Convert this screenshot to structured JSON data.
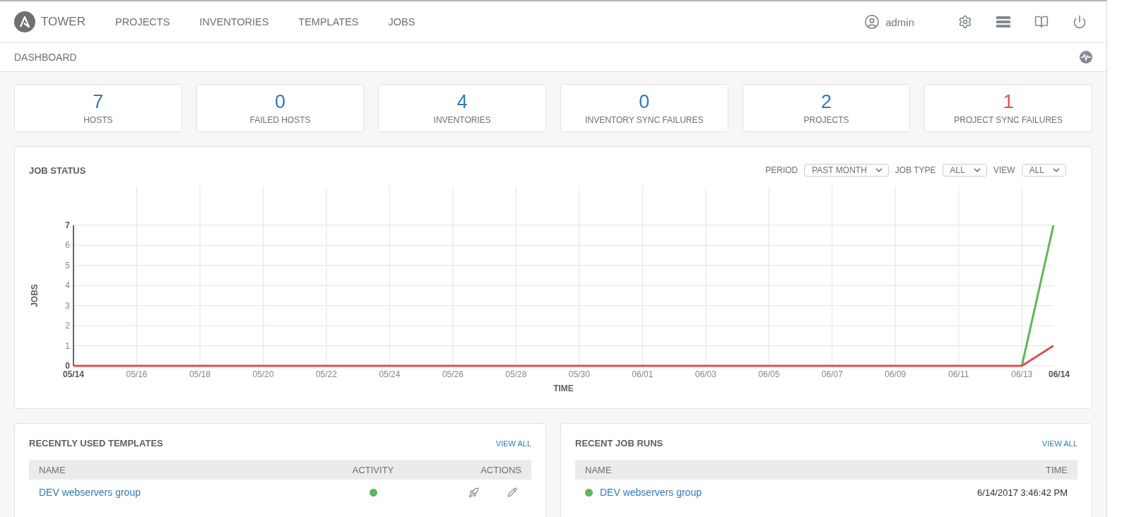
{
  "brand": {
    "name": "TOWER"
  },
  "nav": [
    {
      "label": "PROJECTS"
    },
    {
      "label": "INVENTORIES"
    },
    {
      "label": "TEMPLATES"
    },
    {
      "label": "JOBS"
    }
  ],
  "user": {
    "name": "admin"
  },
  "breadcrumb": "DASHBOARD",
  "counts": [
    {
      "value": "7",
      "label": "HOSTS",
      "color": "#337ab7"
    },
    {
      "value": "0",
      "label": "FAILED HOSTS",
      "color": "#337ab7"
    },
    {
      "value": "4",
      "label": "INVENTORIES",
      "color": "#337ab7"
    },
    {
      "value": "0",
      "label": "INVENTORY SYNC FAILURES",
      "color": "#337ab7"
    },
    {
      "value": "2",
      "label": "PROJECTS",
      "color": "#337ab7"
    },
    {
      "value": "1",
      "label": "PROJECT SYNC FAILURES",
      "color": "#d9534f"
    }
  ],
  "job_status": {
    "title": "JOB STATUS",
    "filters": [
      {
        "label": "PERIOD",
        "value": "PAST MONTH"
      },
      {
        "label": "JOB TYPE",
        "value": "ALL"
      },
      {
        "label": "VIEW",
        "value": "ALL"
      }
    ],
    "chart_data": {
      "type": "line",
      "xlabel": "TIME",
      "ylabel": "JOBS",
      "categories": [
        "05/14",
        null,
        "05/16",
        null,
        "05/18",
        null,
        "05/20",
        null,
        "05/22",
        null,
        "05/24",
        null,
        "05/26",
        null,
        "05/28",
        null,
        "05/30",
        null,
        "06/01",
        null,
        "06/03",
        null,
        "06/05",
        null,
        "06/07",
        null,
        "06/09",
        null,
        "06/11",
        null,
        "06/13",
        "06/14"
      ],
      "series": [
        {
          "color": "#5cb85c",
          "values": [
            null,
            null,
            null,
            null,
            null,
            null,
            null,
            null,
            null,
            null,
            null,
            null,
            null,
            null,
            null,
            null,
            null,
            null,
            null,
            null,
            null,
            null,
            null,
            null,
            null,
            null,
            null,
            null,
            null,
            null,
            0,
            7
          ]
        },
        {
          "color": "#d9534f",
          "values": [
            0,
            0,
            0,
            0,
            0,
            0,
            0,
            0,
            0,
            0,
            0,
            0,
            0,
            0,
            0,
            0,
            0,
            0,
            0,
            0,
            0,
            0,
            0,
            0,
            0,
            0,
            0,
            0,
            0,
            0,
            0,
            1
          ]
        }
      ],
      "ylim": [
        0,
        7
      ],
      "grid": true,
      "yticks": [
        0,
        1,
        2,
        3,
        4,
        5,
        6,
        7
      ]
    }
  },
  "templates": {
    "title": "RECENTLY USED TEMPLATES",
    "view_all": "VIEW ALL",
    "columns": [
      "NAME",
      "ACTIVITY",
      "ACTIONS"
    ],
    "rows": [
      {
        "name": "DEV webservers group",
        "color": "#5cb85c"
      }
    ]
  },
  "job_runs": {
    "title": "RECENT JOB RUNS",
    "view_all": "VIEW ALL",
    "columns": [
      "NAME",
      "TIME"
    ],
    "rows": [
      {
        "name": "DEV webservers group",
        "time": "6/14/2017 3:46:42 PM",
        "color": "#5cb85c"
      }
    ]
  }
}
